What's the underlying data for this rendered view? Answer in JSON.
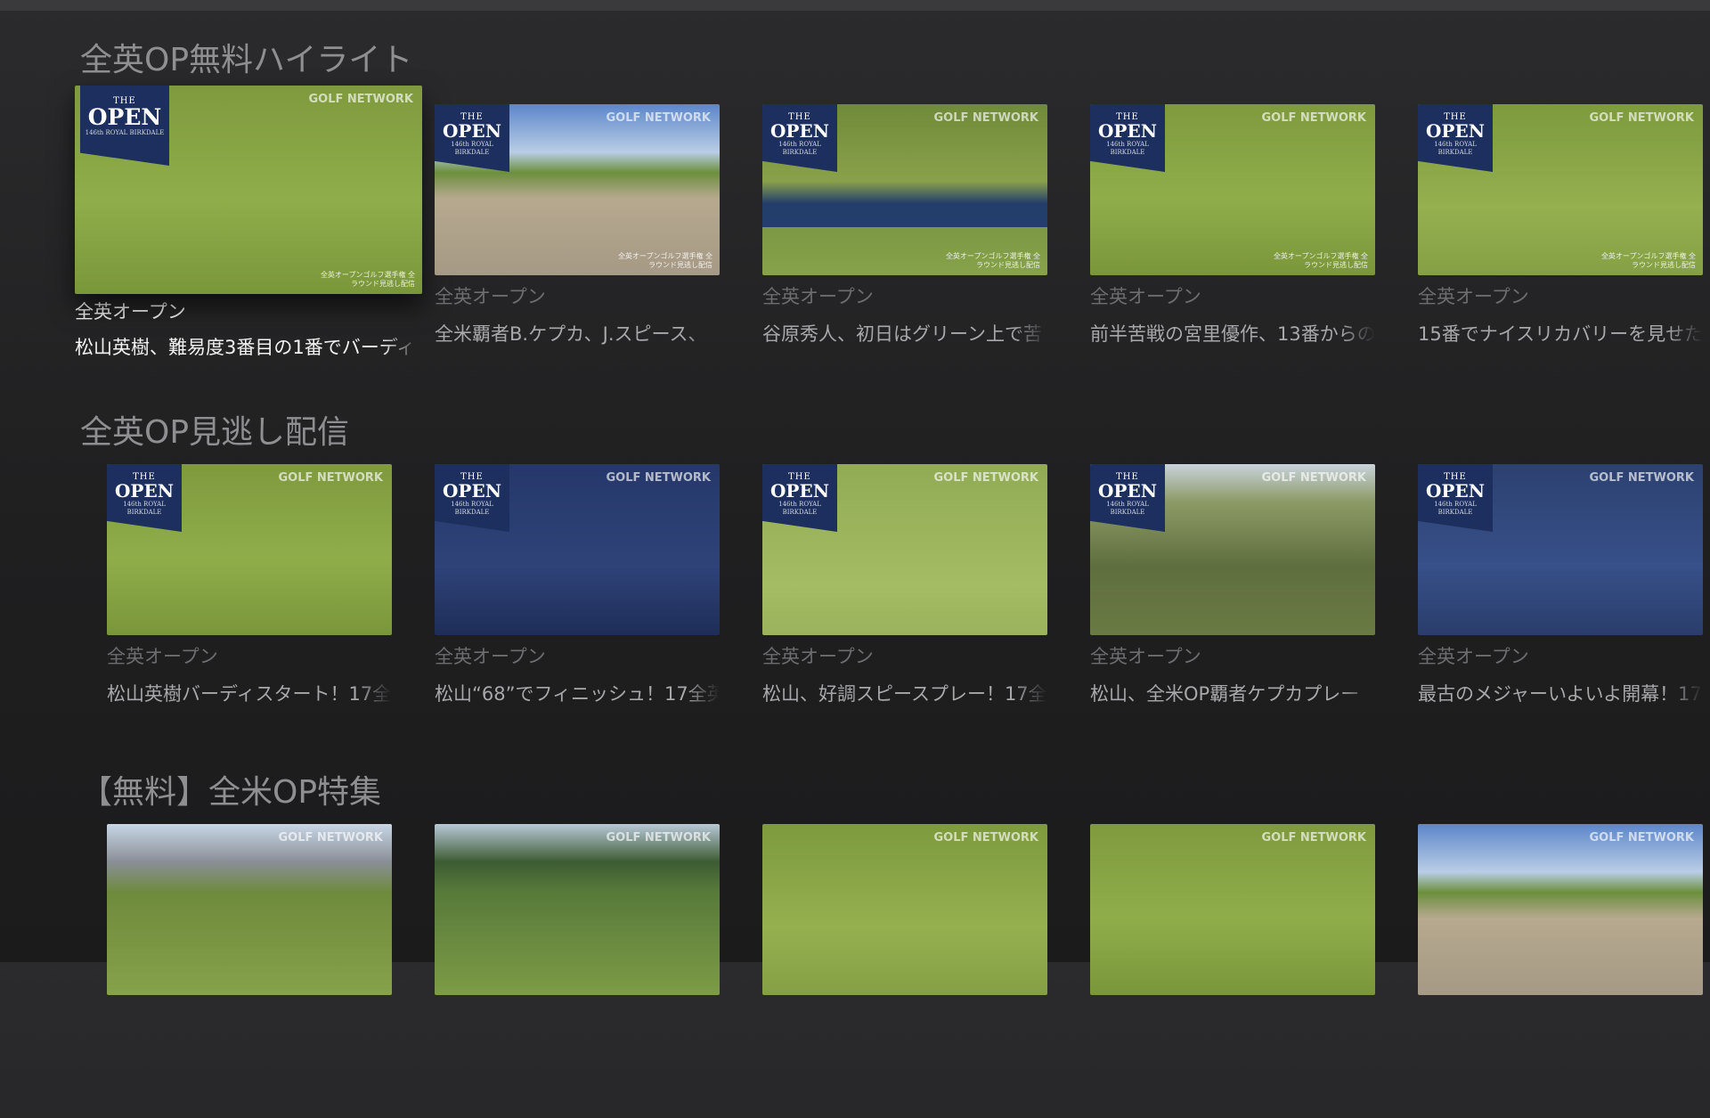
{
  "logo": {
    "line1": "THE",
    "line2": "OPEN",
    "line3": "146th ROYAL BIRKDALE"
  },
  "network_label": "GOLF NETWORK",
  "thumb_caption": "全英オープンゴルフ選手権 全ラウンド見逃し配信",
  "shelves": [
    {
      "title": "全英OP無料ハイライト",
      "cards": [
        {
          "category": "全英オープン",
          "title": "松山英樹、難易度3番目の1番でバーディ",
          "focused": true,
          "scene": "green"
        },
        {
          "category": "全英オープン",
          "title": "全米覇者B.ケプカ、J.スピース、",
          "scene": "bunker"
        },
        {
          "category": "全英オープン",
          "title": "谷原秀人、初日はグリーン上で苦",
          "scene": "tee"
        },
        {
          "category": "全英オープン",
          "title": "前半苦戦の宮里優作、13番からの",
          "scene": "green"
        },
        {
          "category": "全英オープン",
          "title": "15番でナイスリカバリーを見せた",
          "scene": "fairway"
        }
      ]
    },
    {
      "title": "全英OP見逃し配信",
      "cards": [
        {
          "category": "全英オープン",
          "title": "松山英樹バーディスタート！17全",
          "scene": "green"
        },
        {
          "category": "全英オープン",
          "title": "松山“68”でフィニッシュ！17全英",
          "scene": "press"
        },
        {
          "category": "全英オープン",
          "title": "松山、好調スピースプレー！17全",
          "scene": "putting"
        },
        {
          "category": "全英オープン",
          "title": "松山、全米OP覇者ケプカプレー",
          "scene": "rough"
        },
        {
          "category": "全英オープン",
          "title": "最古のメジャーいよいよ開幕！17",
          "scene": "interview"
        }
      ]
    },
    {
      "title": "【無料】全米OP特集",
      "cards": [
        {
          "category": "",
          "title": "",
          "scene": "stands"
        },
        {
          "category": "",
          "title": "",
          "scene": "trees"
        },
        {
          "category": "",
          "title": "",
          "scene": "fairway"
        },
        {
          "category": "",
          "title": "",
          "scene": "green"
        },
        {
          "category": "",
          "title": "",
          "scene": "bunker"
        }
      ]
    }
  ]
}
